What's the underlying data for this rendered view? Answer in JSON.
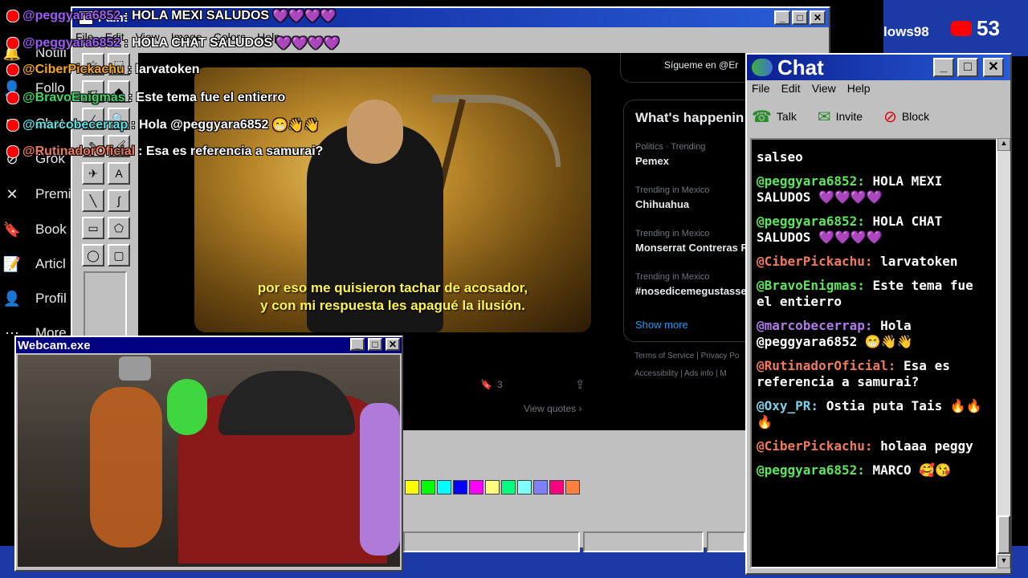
{
  "twitter_sidebar": {
    "items": [
      "Notifi",
      "Follo",
      "Chat",
      "Grok",
      "Premi",
      "Book",
      "Articl",
      "Profil",
      "More"
    ]
  },
  "top_right": {
    "os_label": "lows98",
    "viewer_count": "53"
  },
  "paint": {
    "title": "Paint",
    "menu": [
      "File",
      "Edit",
      "View",
      "Image",
      "Colors",
      "Help"
    ]
  },
  "overlay_chat": [
    {
      "user": "@peggyara6852",
      "text": ": HOLA MEXI SALUDOS",
      "emoji": "💜💜💜💜",
      "color": "#9d5cf5"
    },
    {
      "user": "@peggyara6852",
      "text": ": HOLA CHAT SALUDOS",
      "emoji": "💜💜💜💜",
      "color": "#9d5cf5"
    },
    {
      "user": "@CiberPickachu",
      "text": ": larvatoken",
      "emoji": "",
      "color": "#f5a623"
    },
    {
      "user": "@BravoEnigmas",
      "text": ": Este tema fue el entierro",
      "emoji": "",
      "color": "#41d66a"
    },
    {
      "user": "@marcobecerrap",
      "text": ": Hola @peggyara6852",
      "emoji": "😁👋👋",
      "color": "#5ce0e0"
    },
    {
      "user": "@RutinadorOficial",
      "text": ": Esa es referencia a samurai?",
      "emoji": "",
      "color": "#f07a5c"
    }
  ],
  "tweet": {
    "follow_text": "Sígueme en @Er",
    "subtitle_line1": "por eso me quisieron tachar de acosador,",
    "subtitle_line2": "y con mi respuesta les apagué la ilusión.",
    "bookmark_count": "3",
    "view_quotes": "View quotes ›"
  },
  "trends": {
    "header": "What's happenin",
    "items": [
      {
        "context": "Politics · Trending",
        "name": "Pemex"
      },
      {
        "context": "Trending in Mexico",
        "name": "Chihuahua"
      },
      {
        "context": "Trending in Mexico",
        "name": "Monserrat Contreras R"
      },
      {
        "context": "Trending in Mexico",
        "name": "#nosedicemegustasse"
      }
    ],
    "show_more": "Show more",
    "footer1": "Terms of Service | Privacy Po",
    "footer2": "Accessibility | Ads info | M"
  },
  "palette": [
    "#ffff00",
    "#00ff00",
    "#00ffff",
    "#0000ff",
    "#ff00ff",
    "#ffff80",
    "#00ff80",
    "#80ffff",
    "#8080ff",
    "#ff0080",
    "#ff8040"
  ],
  "webcam": {
    "title": "Webcam.exe"
  },
  "chat": {
    "title": "Chat",
    "menu": [
      "File",
      "Edit",
      "View",
      "Help"
    ],
    "tools": [
      "Talk",
      "Invite",
      "Block"
    ],
    "messages": [
      {
        "user": "",
        "text": "salseo",
        "color": "#ffffff"
      },
      {
        "user": "@peggyara6852:",
        "text": "HOLA MEXI SALUDOS 💜💜💜💜",
        "color": "#5ce65c"
      },
      {
        "user": "@peggyara6852:",
        "text": "HOLA CHAT SALUDOS 💜💜💜💜",
        "color": "#5ce65c"
      },
      {
        "user": "@CiberPickachu:",
        "text": "larvatoken",
        "color": "#f07a5c"
      },
      {
        "user": "@BravoEnigmas:",
        "text": "Este tema fue el entierro",
        "color": "#5ce65c"
      },
      {
        "user": "@marcobecerrap:",
        "text": "Hola @peggyara6852 😁👋👋",
        "color": "#b07ae8"
      },
      {
        "user": "@RutinadorOficial:",
        "text": "Esa es referencia a samurai?",
        "color": "#f07a5c"
      },
      {
        "user": "@Oxy_PR:",
        "text": "Ostia puta Tais 🔥🔥🔥",
        "color": "#7ad0e8"
      },
      {
        "user": "@CiberPickachu:",
        "text": "holaaa peggy",
        "color": "#f07a5c"
      },
      {
        "user": "@peggyara6852:",
        "text": "MARCO 🥰😘",
        "color": "#5ce65c"
      }
    ]
  }
}
